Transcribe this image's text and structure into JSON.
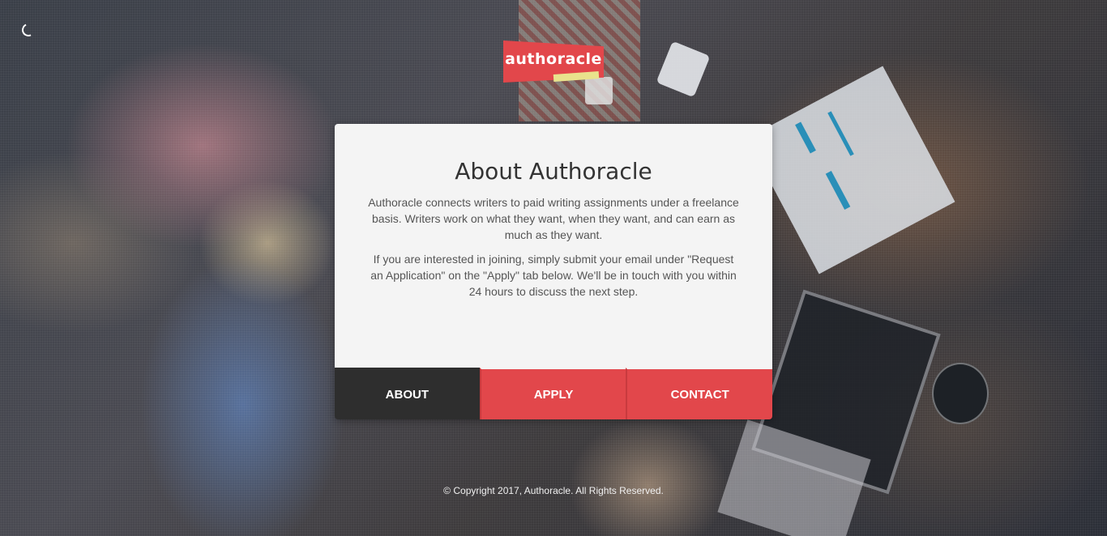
{
  "logo": {
    "text": "authoracle",
    "colors": {
      "primary": "#e2474b",
      "accent": "#e9e28c"
    }
  },
  "loader": {
    "icon": "spinner-icon"
  },
  "about": {
    "title": "About Authoracle",
    "paragraphs": [
      "Authoracle connects writers to paid writing assignments under a freelance basis. Writers work on what they want, when they want, and can earn as much as they want.",
      "If you are interested in joining, simply submit your email under \"Request an Application\" on the \"Apply\" tab below. We'll be in touch with you within 24 hours to discuss the next step."
    ]
  },
  "tabs": [
    {
      "label": "ABOUT",
      "active": true
    },
    {
      "label": "APPLY",
      "active": false
    },
    {
      "label": "CONTACT",
      "active": false
    }
  ],
  "footer": {
    "copyright": "© Copyright 2017, Authoracle. All Rights Reserved."
  },
  "theme": {
    "tab_active": "#2e2e2e",
    "tab_inactive": "#e2474b",
    "card_background": "#f4f4f4"
  }
}
